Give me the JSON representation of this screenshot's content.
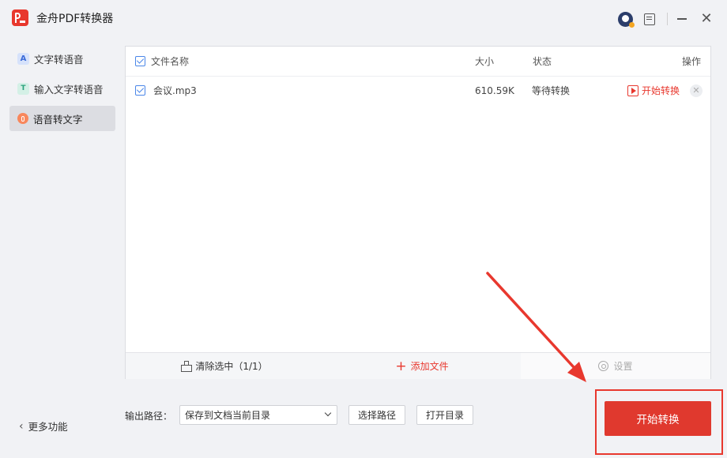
{
  "app": {
    "title": "金舟PDF转换器"
  },
  "sidebar": {
    "items": [
      {
        "label": "文字转语音",
        "icon": "letter-a-icon",
        "active": false
      },
      {
        "label": "输入文字转语音",
        "icon": "text-t-icon",
        "active": false
      },
      {
        "label": "语音转文字",
        "icon": "microphone-icon",
        "active": true
      }
    ],
    "more_label": "更多功能"
  },
  "table": {
    "columns": {
      "name": "文件名称",
      "size": "大小",
      "status": "状态",
      "action": "操作"
    },
    "rows": [
      {
        "checked": true,
        "name": "会议.mp3",
        "size": "610.59K",
        "status": "等待转换",
        "action_label": "开始转换"
      }
    ]
  },
  "panel_footer": {
    "clear_label": "清除选中（1/1）",
    "add_label": "添加文件",
    "settings_label": "设置"
  },
  "output": {
    "label": "输出路径：",
    "selected": "保存到文档当前目录",
    "choose_path_label": "选择路径",
    "open_dir_label": "打开目录"
  },
  "start_button": {
    "label": "开始转换"
  },
  "colors": {
    "accent": "#e0392e",
    "checkbox": "#4a86e8",
    "sidebar_active": "#dcdde2",
    "background": "#f1f2f5"
  }
}
